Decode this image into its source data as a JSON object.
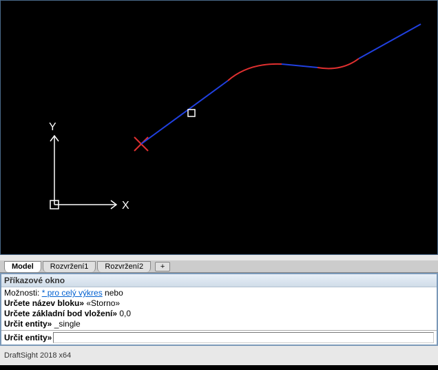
{
  "viewport": {
    "axis_y_label": "Y",
    "axis_x_label": "X"
  },
  "tabs": {
    "items": [
      {
        "label": "Model",
        "active": true
      },
      {
        "label": "Rozvržení1",
        "active": false
      },
      {
        "label": "Rozvržení2",
        "active": false
      }
    ],
    "add_label": "+"
  },
  "command_window": {
    "title": "Příkazové okno",
    "history": {
      "line1_a": "Možnosti: ",
      "line1_link": "* pro celý výkres",
      "line1_b": " nebo",
      "line2_a": "Určete název bloku»",
      "line2_b": " «Storno»",
      "line3_a": "Určete základní bod vložení»",
      "line3_b": " 0,0",
      "line4_a": "Určit entity»",
      "line4_b": " _single"
    },
    "prompt": "Určit entity»",
    "input_value": ""
  },
  "status": {
    "text": "DraftSight 2018 x64"
  }
}
